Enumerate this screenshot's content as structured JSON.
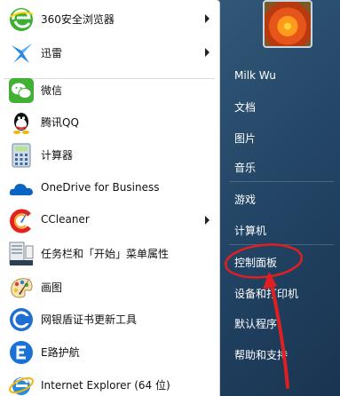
{
  "left_items": [
    {
      "label": "360安全浏览器",
      "icon": "360-browser-icon",
      "has_arrow": true
    },
    {
      "label": "迅雷",
      "icon": "xunlei-icon",
      "has_arrow": true
    },
    {
      "label": "微信",
      "icon": "wechat-icon",
      "has_arrow": false
    },
    {
      "label": "腾讯QQ",
      "icon": "qq-icon",
      "has_arrow": false
    },
    {
      "label": "计算器",
      "icon": "calculator-icon",
      "has_arrow": false
    },
    {
      "label": "OneDrive for Business",
      "icon": "onedrive-icon",
      "has_arrow": false
    },
    {
      "label": "CCleaner",
      "icon": "ccleaner-icon",
      "has_arrow": true
    },
    {
      "label": "任务栏和「开始」菜单属性",
      "icon": "taskbar-properties-icon",
      "has_arrow": false
    },
    {
      "label": "画图",
      "icon": "paint-icon",
      "has_arrow": false
    },
    {
      "label": "网银盾证书更新工具",
      "icon": "bank-shield-icon",
      "has_arrow": false
    },
    {
      "label": "E路护航",
      "icon": "e-escort-icon",
      "has_arrow": false
    },
    {
      "label": "Internet Explorer (64 位)",
      "icon": "ie-icon",
      "has_arrow": false
    }
  ],
  "right_items": {
    "user": "Milk Wu",
    "documents": "文档",
    "pictures": "图片",
    "music": "音乐",
    "games": "游戏",
    "computer": "计算机",
    "control_panel": "控制面板",
    "devices": "设备和打印机",
    "default_programs": "默认程序",
    "help": "帮助和支持"
  },
  "annotation_color": "#e02020",
  "highlighted_item": "控制面板"
}
